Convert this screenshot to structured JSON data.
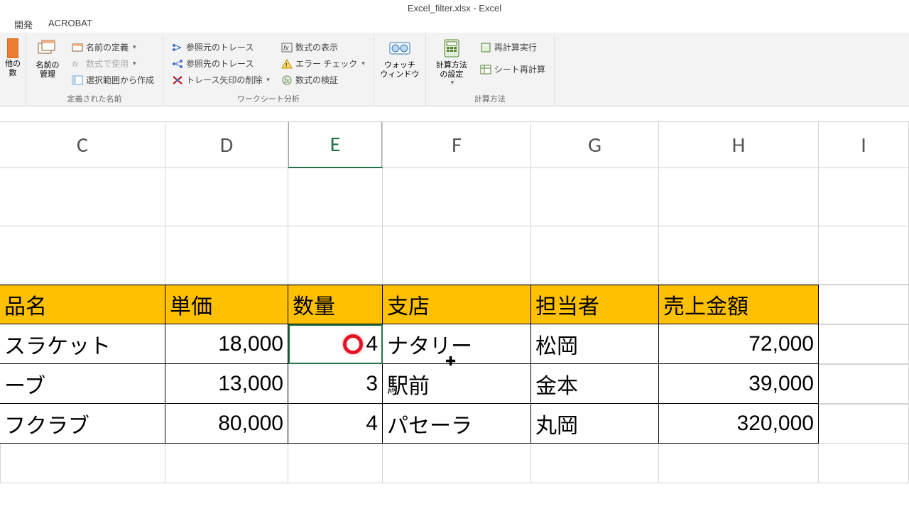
{
  "title": "Excel_filter.xlsx - Excel",
  "tabs": {
    "dev": "開発",
    "acrobat": "ACROBAT"
  },
  "ribbon": {
    "g0": {
      "btn": "他の\n数",
      "btn_suffix": "▾"
    },
    "g1": {
      "name_mgr": "名前の\n管理",
      "define_name": "名前の定義",
      "use_in_formula": "数式で使用",
      "from_selection": "選択範囲から作成",
      "label": "定義された名前"
    },
    "g2": {
      "trace_precedents": "参照元のトレース",
      "trace_dependents": "参照先のトレース",
      "remove_arrows": "トレース矢印の削除",
      "show_formulas": "数式の表示",
      "error_check": "エラー チェック",
      "evaluate": "数式の検証",
      "label": "ワークシート分析"
    },
    "g3": {
      "watch": "ウォッチ\nウィンドウ"
    },
    "g4": {
      "calc_options": "計算方法\nの設定",
      "calc_now": "再計算実行",
      "calc_sheet": "シート再計算",
      "label": "計算方法"
    }
  },
  "columns": {
    "C": "C",
    "D": "D",
    "E": "E",
    "F": "F",
    "G": "G",
    "H": "H",
    "I": "I"
  },
  "headers": {
    "C": "品名",
    "D": "単価",
    "E": "数量",
    "F": "支店",
    "G": "担当者",
    "H": "売上金額"
  },
  "rows": [
    {
      "C": "スラケット",
      "D": "18,000",
      "E": "4",
      "F": "ナタリー",
      "G": "松岡",
      "H": "72,000"
    },
    {
      "C": "ーブ",
      "D": "13,000",
      "E": "3",
      "F": "駅前",
      "G": "金本",
      "H": "39,000"
    },
    {
      "C": "フクラブ",
      "D": "80,000",
      "E": "4",
      "F": "パセーラ",
      "G": "丸岡",
      "H": "320,000"
    }
  ]
}
